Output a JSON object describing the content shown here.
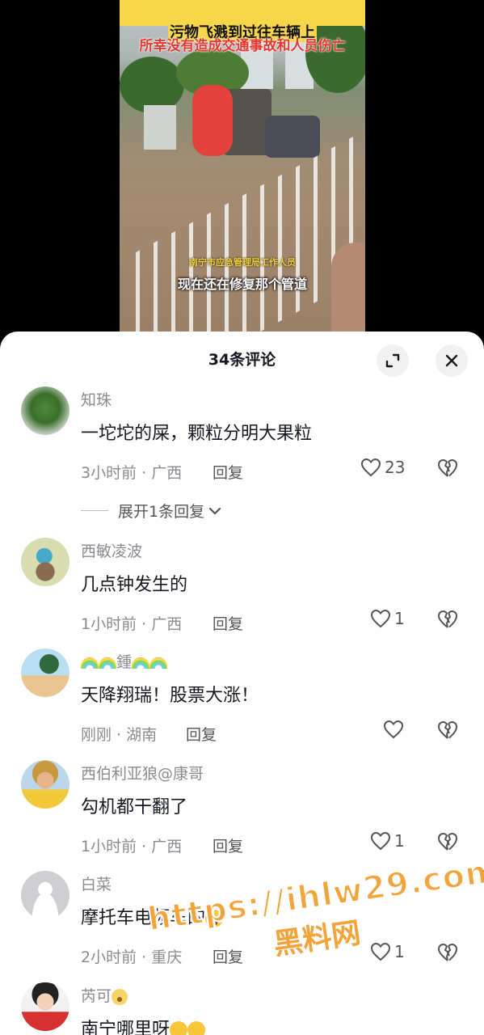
{
  "video": {
    "caption_top": "污物飞溅到过往车辆上",
    "caption_red": "所幸没有造成交通事故和人员伤亡",
    "speaker_label": "南宁市应急管理局工作人员",
    "subtitle": "现在还在修复那个管道"
  },
  "panel": {
    "title": "34条评论",
    "expand_icon": "expand-icon",
    "close_icon": "close-icon"
  },
  "comments": [
    {
      "user": "知珠",
      "text": "一坨坨的屎，颗粒分明大果粒",
      "time": "3小时前",
      "region": "广西",
      "reply": "回复",
      "likes": "23",
      "expand_label": "展开1条回复"
    },
    {
      "user": "西敏凌波",
      "text": "几点钟发生的",
      "time": "1小时前",
      "region": "广西",
      "reply": "回复",
      "likes": "1"
    },
    {
      "user": "鍾",
      "text": "天降翔瑞！股票大涨！",
      "time": "刚刚",
      "region": "湖南",
      "reply": "回复",
      "likes": ""
    },
    {
      "user": "西伯利亚狼@康哥",
      "text": "勾机都干翻了",
      "time": "1小时前",
      "region": "广西",
      "reply": "回复",
      "likes": "1"
    },
    {
      "user": "白菜",
      "text": "摩托车电频车的",
      "time": "2小时前",
      "region": "重庆",
      "reply": "回复",
      "likes": "1"
    },
    {
      "user": "芮可",
      "text": "南宁哪里呀"
    }
  ],
  "watermark": {
    "url": "https://ihlw29.com",
    "cn": "黑料网"
  },
  "colors": {
    "panel_bg": "#ffffff",
    "text_primary": "#161823",
    "text_secondary": "#8a8b91",
    "watermark": "#f2a33a"
  }
}
